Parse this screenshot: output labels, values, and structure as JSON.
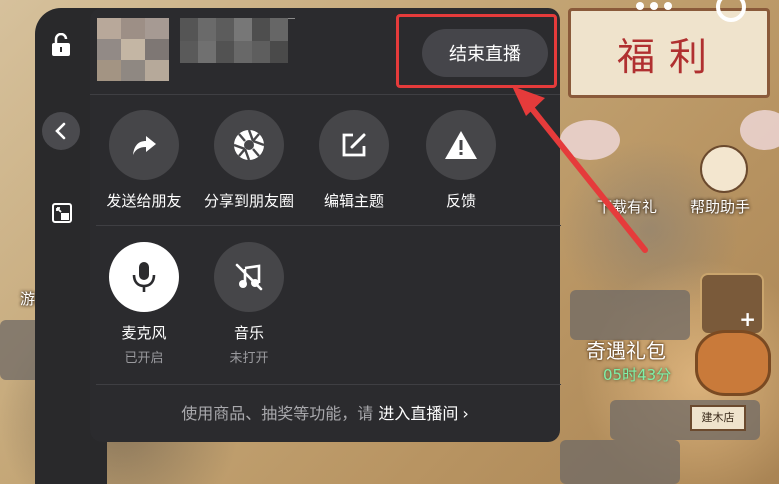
{
  "panel": {
    "end_live_button": "结束直播",
    "actions_row1": [
      {
        "label": "发送给朋友",
        "icon": "share-arrow-icon"
      },
      {
        "label": "分享到朋友圈",
        "icon": "moments-icon"
      },
      {
        "label": "编辑主题",
        "icon": "edit-icon"
      },
      {
        "label": "反馈",
        "icon": "warning-icon"
      }
    ],
    "actions_row2": [
      {
        "label": "麦克风",
        "status": "已开启",
        "icon": "microphone-icon"
      },
      {
        "label": "音乐",
        "status": "未打开",
        "icon": "music-off-icon"
      }
    ],
    "footer": {
      "text": "使用商品、抽奖等功能，请 ",
      "link": "进入直播间",
      "chevron": "›"
    }
  },
  "game": {
    "sign": "福利",
    "labels": {
      "download_gift": "下载有礼",
      "helper": "帮助助手",
      "trans": "游戏助"
    },
    "gift": {
      "title": "奇遇礼包",
      "timer": "05时43分"
    },
    "plaque": "建木店"
  },
  "colors": {
    "panel_bg": "#2b2b2e",
    "highlight": "#e53b3b",
    "timer": "#7ef0a8"
  }
}
